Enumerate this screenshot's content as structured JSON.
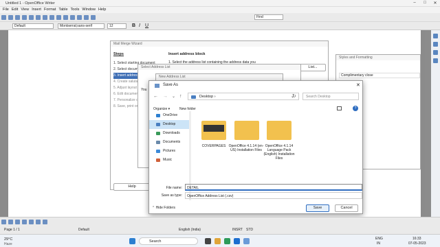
{
  "app": {
    "title": "Untitled 1 - OpenOffice Writer",
    "menu": [
      "File",
      "Edit",
      "View",
      "Insert",
      "Format",
      "Table",
      "Tools",
      "Window",
      "Help"
    ],
    "find_placeholder": "Find",
    "style": "Default",
    "font": "Montserrat;sans-serif",
    "size": "12"
  },
  "mailmerge": {
    "title": "Mail Merge Wizard",
    "steps_heading": "Steps",
    "steps": [
      "1. Select starting document",
      "2. Select document type",
      "3. Insert address block",
      "4. Create salutation",
      "5. Adjust layout",
      "6. Edit document",
      "7. Personalize document",
      "8. Save, print or send"
    ],
    "right_heading": "Insert address block",
    "right_text": "1.   Select the address list containing the address data you",
    "list_button": "List...",
    "help": "Help"
  },
  "addresslist": {
    "title": "Select Address List",
    "you": "You"
  },
  "newaddr": {
    "title": "New Address List"
  },
  "styles": {
    "title": "Styles and Formatting",
    "item": "Complimentary close"
  },
  "saveas": {
    "title": "Save As",
    "path_root": "Desktop",
    "search_placeholder": "Search Desktop",
    "organize": "Organize",
    "new_folder": "New folder",
    "nav": [
      "OneDrive",
      "Desktop",
      "Downloads",
      "Documents",
      "Pictures",
      "Music"
    ],
    "folders": [
      "COVERPAGES",
      "OpenOffice 4.1.14 (en-US) Installation Files",
      "OpenOffice 4.1.14 Language Pack (English) Installation Files"
    ],
    "filename_label": "File name:",
    "filename": "DETAIL",
    "savetype_label": "Save as type:",
    "savetype": "OpenOffice Address List (.csv)",
    "hide_folders": "Hide Folders",
    "save": "Save",
    "cancel": "Cancel"
  },
  "status": {
    "page": "Page 1 / 1",
    "style": "Default",
    "lang": "English (India)",
    "insrt": "INSRT",
    "std": "STD"
  },
  "taskbar": {
    "temp": "29°C",
    "weather": "Haze",
    "search": "Search",
    "time": "16:33",
    "date": "07-05-2023",
    "lang": "ENG",
    "region": "IN"
  }
}
